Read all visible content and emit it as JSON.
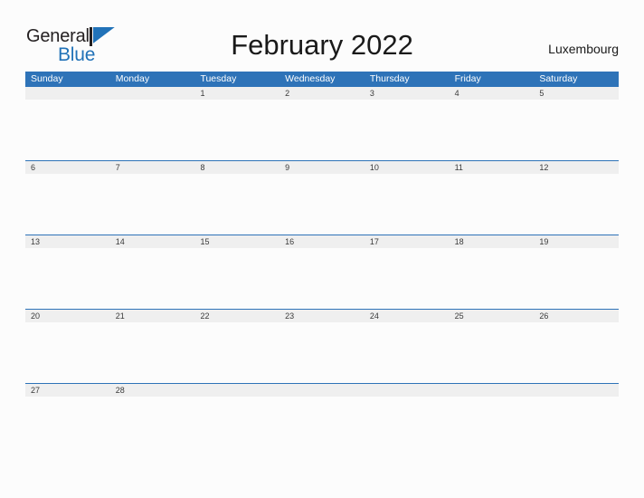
{
  "logo": {
    "word_dark": "General",
    "word_blue": "Blue",
    "flag_icon": "blue-triangle-flag-icon",
    "dark_color": "#231f20",
    "blue_color": "#2172b8"
  },
  "header": {
    "title": "February 2022",
    "country": "Luxembourg"
  },
  "calendar": {
    "header_bg": "#2e73b8",
    "header_text_color": "#ffffff",
    "date_strip_bg": "#efefef",
    "rule_color": "#2e73b8",
    "body_bg": "#fcfcfc",
    "weekdays": [
      "Sunday",
      "Monday",
      "Tuesday",
      "Wednesday",
      "Thursday",
      "Friday",
      "Saturday"
    ],
    "weeks": [
      {
        "days": [
          "",
          "",
          "1",
          "2",
          "3",
          "4",
          "5"
        ]
      },
      {
        "days": [
          "6",
          "7",
          "8",
          "9",
          "10",
          "11",
          "12"
        ]
      },
      {
        "days": [
          "13",
          "14",
          "15",
          "16",
          "17",
          "18",
          "19"
        ]
      },
      {
        "days": [
          "20",
          "21",
          "22",
          "23",
          "24",
          "25",
          "26"
        ]
      },
      {
        "days": [
          "27",
          "28",
          "",
          "",
          "",
          "",
          ""
        ]
      }
    ]
  }
}
